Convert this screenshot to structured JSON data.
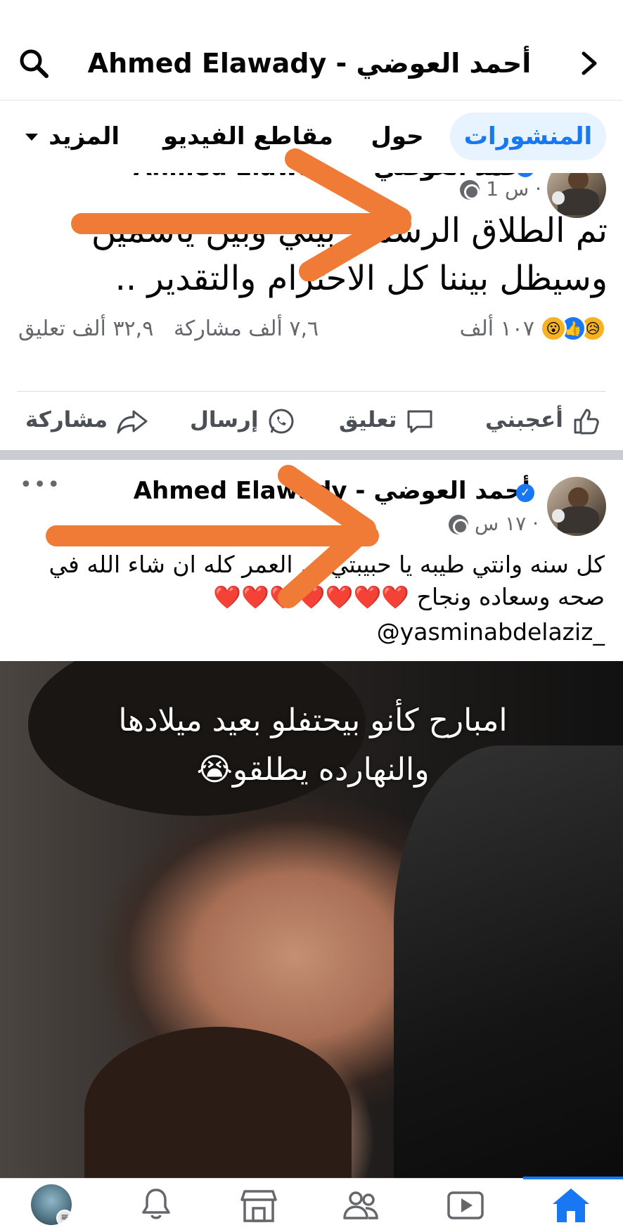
{
  "header": {
    "title": "Ahmed Elawady - أحمد العوضي",
    "search_icon": "search-icon",
    "back_icon": "chevron-right-icon"
  },
  "tabs": [
    {
      "label": "المنشورات",
      "active": true
    },
    {
      "label": "حول",
      "active": false
    },
    {
      "label": "مقاطع الفيديو",
      "active": false
    },
    {
      "label": "المزيد",
      "active": false
    }
  ],
  "post1": {
    "author": "Ahmed Elawady - أحمد العوضي",
    "time": "1 س ·",
    "text": "تم الطلاق الرسمي بيني وبين ياسمين وسيظل بيننا كل الاحترام والتقدير ..",
    "reaction_count": "١٠٧ ألف",
    "comments": "٣٢,٩ ألف تعليق",
    "shares": "٧,٦ ألف مشاركة",
    "actions": {
      "like": "أعجبني",
      "comment": "تعليق",
      "send": "إرسال",
      "share": "مشاركة"
    }
  },
  "post2": {
    "author": "Ahmed Elawady - أحمد العوضي",
    "time": "١٧ س ·",
    "caption_line1": "كل سنه وانتي طيبه يا حبيبتي ... العمر كله ان شاء الله في",
    "caption_line2": "صحه وسعاده ونجاح",
    "hearts": "❤️❤️❤️❤️❤️❤️❤️",
    "mention": "@yasminabdelaziz_",
    "overlay_line1": "امبارح كأنو بيحتفلو بعيد ميلادها",
    "overlay_line2": "والنهارده يطلقو😭"
  },
  "colors": {
    "brand": "#1877f2",
    "arrow": "#f07b36",
    "muted": "#65676b"
  },
  "bottom_nav": [
    "profile-menu",
    "notifications",
    "marketplace",
    "groups",
    "video",
    "home"
  ]
}
